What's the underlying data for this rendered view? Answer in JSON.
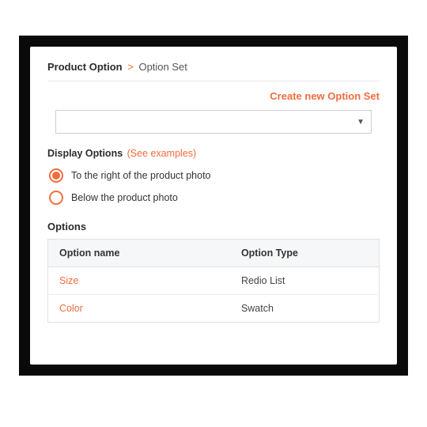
{
  "breadcrumb": {
    "root": "Product Option",
    "sep": ">",
    "leaf": "Option Set"
  },
  "create_link": "Create new Option Set",
  "option_set_select": {
    "value": ""
  },
  "display_options": {
    "label": "Display Options",
    "hint": "(See examples)",
    "choices": [
      {
        "label": "To the right of the product photo",
        "selected": true
      },
      {
        "label": "Below the product photo",
        "selected": false
      }
    ]
  },
  "options_section": {
    "heading": "Options",
    "columns": {
      "name": "Option name",
      "type": "Option Type"
    },
    "rows": [
      {
        "name": "Size",
        "type": "Redio List"
      },
      {
        "name": "Color",
        "type": "Swatch"
      }
    ]
  },
  "colors": {
    "accent": "#f26c3d"
  }
}
